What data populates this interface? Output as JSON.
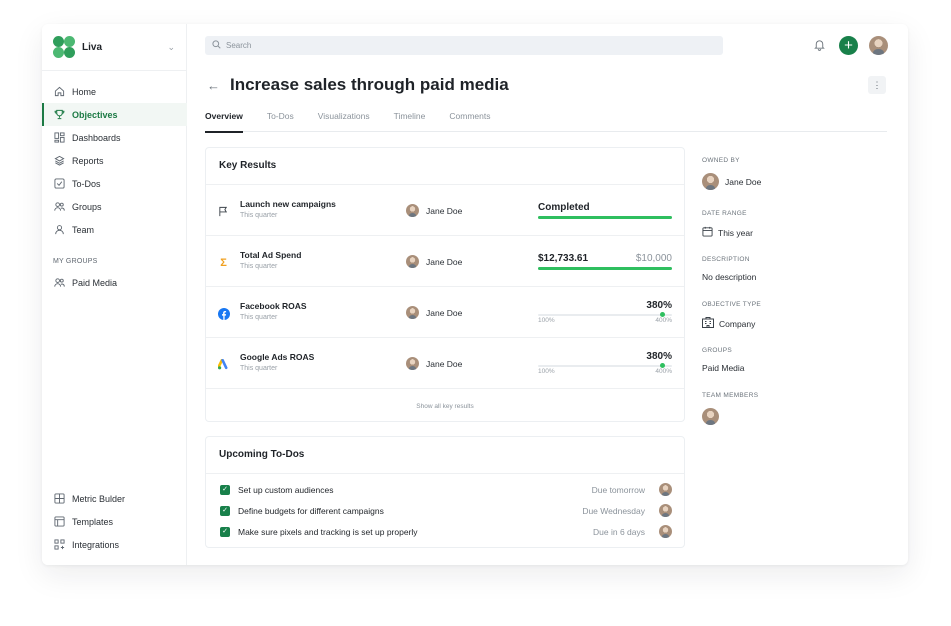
{
  "brand": {
    "name": "Liva"
  },
  "colors": {
    "accent": "#18804a",
    "progress": "#2fbf5f"
  },
  "sidebar": {
    "items": [
      {
        "label": "Home",
        "icon": "home-icon"
      },
      {
        "label": "Objectives",
        "icon": "trophy-icon",
        "active": true
      },
      {
        "label": "Dashboards",
        "icon": "dashboard-icon"
      },
      {
        "label": "Reports",
        "icon": "layers-icon"
      },
      {
        "label": "To-Dos",
        "icon": "checkbox-icon"
      },
      {
        "label": "Groups",
        "icon": "users-icon"
      },
      {
        "label": "Team",
        "icon": "user-icon"
      }
    ],
    "group_label": "MY GROUPS",
    "groups": [
      {
        "label": "Paid Media",
        "icon": "users-icon"
      }
    ],
    "bottom": [
      {
        "label": "Metric Bulder",
        "icon": "calculator-icon"
      },
      {
        "label": "Templates",
        "icon": "template-icon"
      },
      {
        "label": "Integrations",
        "icon": "integrations-icon"
      }
    ]
  },
  "search": {
    "placeholder": "Search"
  },
  "page": {
    "title": "Increase sales through paid media",
    "tabs": [
      "Overview",
      "To-Dos",
      "Visualizations",
      "Timeline",
      "Comments"
    ]
  },
  "key_results": {
    "title": "Key Results",
    "rows": [
      {
        "name": "Launch new campaigns",
        "period": "This quarter",
        "owner": "Jane Doe",
        "icon": "flag-icon",
        "status": "Completed",
        "progress": 1.0
      },
      {
        "name": "Total Ad Spend",
        "period": "This quarter",
        "owner": "Jane Doe",
        "icon": "sigma-icon",
        "value": "$12,733.61",
        "target": "$10,000",
        "progress": 1.0
      },
      {
        "name": "Facebook ROAS",
        "period": "This quarter",
        "owner": "Jane Doe",
        "icon": "facebook-icon",
        "value": "380%",
        "min": "100%",
        "max": "400%",
        "progress": 0.93
      },
      {
        "name": "Google Ads ROAS",
        "period": "This quarter",
        "owner": "Jane Doe",
        "icon": "google-ads-icon",
        "value": "380%",
        "min": "100%",
        "max": "400%",
        "progress": 0.93
      }
    ],
    "show_all": "Show all key results"
  },
  "todos": {
    "title": "Upcoming To-Dos",
    "items": [
      {
        "label": "Set up custom audiences",
        "due": "Due tomorrow"
      },
      {
        "label": "Define budgets for different campaigns",
        "due": "Due Wednesday"
      },
      {
        "label": "Make sure pixels and tracking is set up properly",
        "due": "Due in 6 days"
      }
    ]
  },
  "details": {
    "owned_by_label": "OWNED BY",
    "owned_by": "Jane Doe",
    "date_range_label": "DATE RANGE",
    "date_range": "This year",
    "description_label": "DESCRIPTION",
    "description": "No description",
    "objective_type_label": "OBJECTIVE TYPE",
    "objective_type": "Company",
    "groups_label": "GROUPS",
    "groups": "Paid Media",
    "team_members_label": "TEAM MEMBERS"
  }
}
